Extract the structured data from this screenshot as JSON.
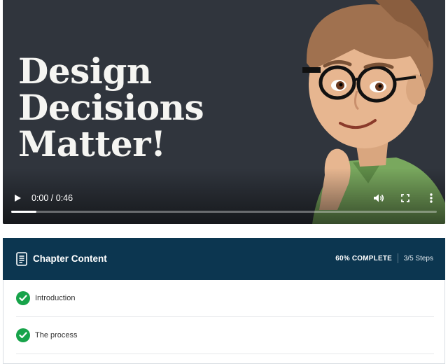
{
  "video": {
    "headline_lines": [
      "Design",
      "Decisions",
      "Matter!"
    ],
    "time_display": "0:00 / 0:46",
    "progress_fraction": 0.06,
    "icons": [
      "play-icon",
      "volume-icon",
      "fullscreen-icon",
      "more-vertical-icon"
    ]
  },
  "chapter": {
    "title": "Chapter Content",
    "complete_label": "60% COMPLETE",
    "steps_label": "3/5 Steps",
    "lessons": [
      {
        "label": "Introduction",
        "completed": true
      },
      {
        "label": "The process",
        "completed": true
      }
    ]
  },
  "colors": {
    "header_bg": "#0c3650",
    "check_green": "#17a34a",
    "video_bg": "#30353d"
  }
}
